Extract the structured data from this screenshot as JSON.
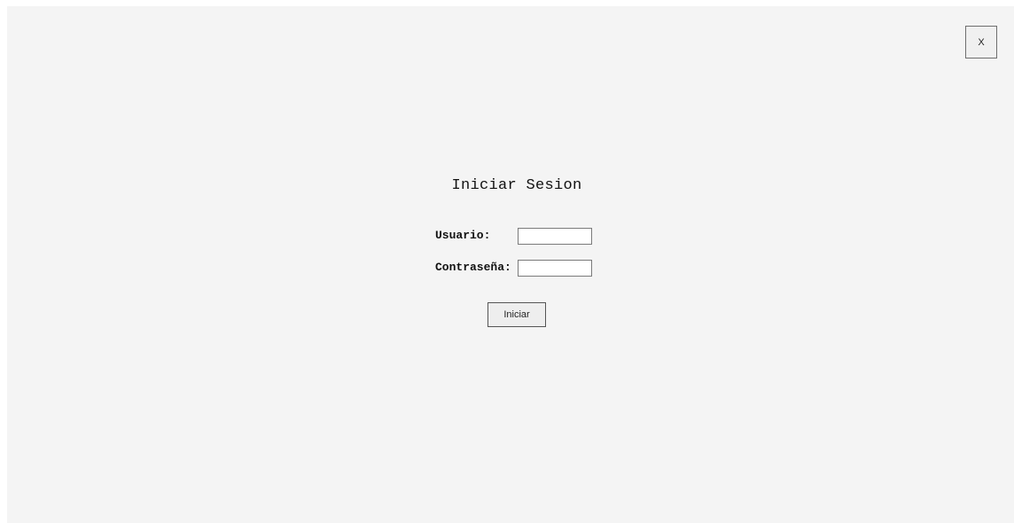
{
  "window": {
    "close_label": "X"
  },
  "login": {
    "title": "Iniciar Sesion",
    "username_label": "Usuario:",
    "username_value": "",
    "password_label": "Contraseña:",
    "password_value": "",
    "submit_label": "Iniciar"
  },
  "colors": {
    "background": "#f4f4f4",
    "field_background": "#ffffff",
    "button_background": "#eeeeee",
    "border": "#6e6e6e"
  }
}
